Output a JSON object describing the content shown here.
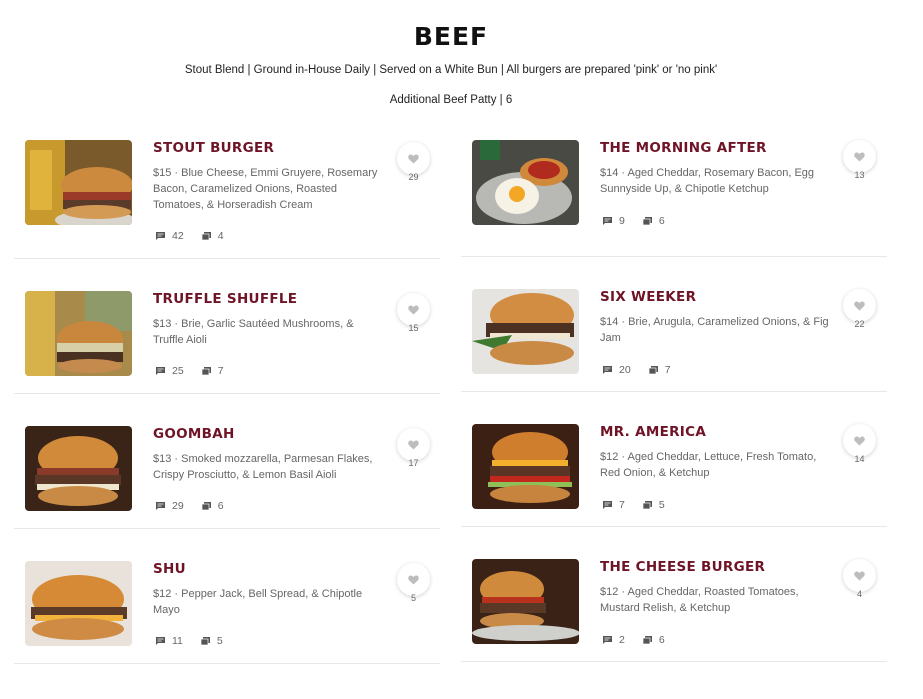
{
  "section": {
    "title": "BEEF",
    "subtitle": "Stout Blend | Ground in-House Daily | Served on a White Bun | All burgers are prepared 'pink' or 'no pink'",
    "extra": "Additional Beef Patty | 6"
  },
  "left_items": [
    {
      "name": "STOUT BURGER",
      "desc": "$15 · Blue Cheese, Emmi Gruyere, Rosemary Bacon, Caramelized Onions, Roasted Tomatoes, & Horseradish Cream",
      "comments": "42",
      "photos": "4",
      "likes": "29"
    },
    {
      "name": "TRUFFLE SHUFFLE",
      "desc": "$13 · Brie, Garlic Sautéed Mushrooms, & Truffle Aioli",
      "comments": "25",
      "photos": "7",
      "likes": "15"
    },
    {
      "name": "GOOMBAH",
      "desc": "$13 · Smoked mozzarella, Parmesan Flakes, Crispy Prosciutto, & Lemon Basil Aioli",
      "comments": "29",
      "photos": "6",
      "likes": "17"
    },
    {
      "name": "SHU",
      "desc": "$12 · Pepper Jack, Bell Spread, & Chipotle Mayo",
      "comments": "11",
      "photos": "5",
      "likes": "5"
    }
  ],
  "right_items": [
    {
      "name": "THE MORNING AFTER",
      "desc": "$14 · Aged Cheddar, Rosemary Bacon, Egg Sunnyside Up, & Chipotle Ketchup",
      "comments": "9",
      "photos": "6",
      "likes": "13"
    },
    {
      "name": "SIX WEEKER",
      "desc": "$14 · Brie, Arugula, Caramelized Onions, & Fig Jam",
      "comments": "20",
      "photos": "7",
      "likes": "22"
    },
    {
      "name": "MR. AMERICA",
      "desc": "$12 · Aged Cheddar, Lettuce, Fresh Tomato, Red Onion, & Ketchup",
      "comments": "7",
      "photos": "5",
      "likes": "14"
    },
    {
      "name": "THE CHEESE BURGER",
      "desc": "$12 · Aged Cheddar, Roasted Tomatoes, Mustard Relish, & Ketchup",
      "comments": "2",
      "photos": "6",
      "likes": "4"
    }
  ],
  "colors": {
    "item_name": "#6e1426",
    "text": "#666666"
  },
  "icons": {
    "comment": "comment-icon",
    "photo": "photo-gallery-icon",
    "like": "heart-icon"
  }
}
